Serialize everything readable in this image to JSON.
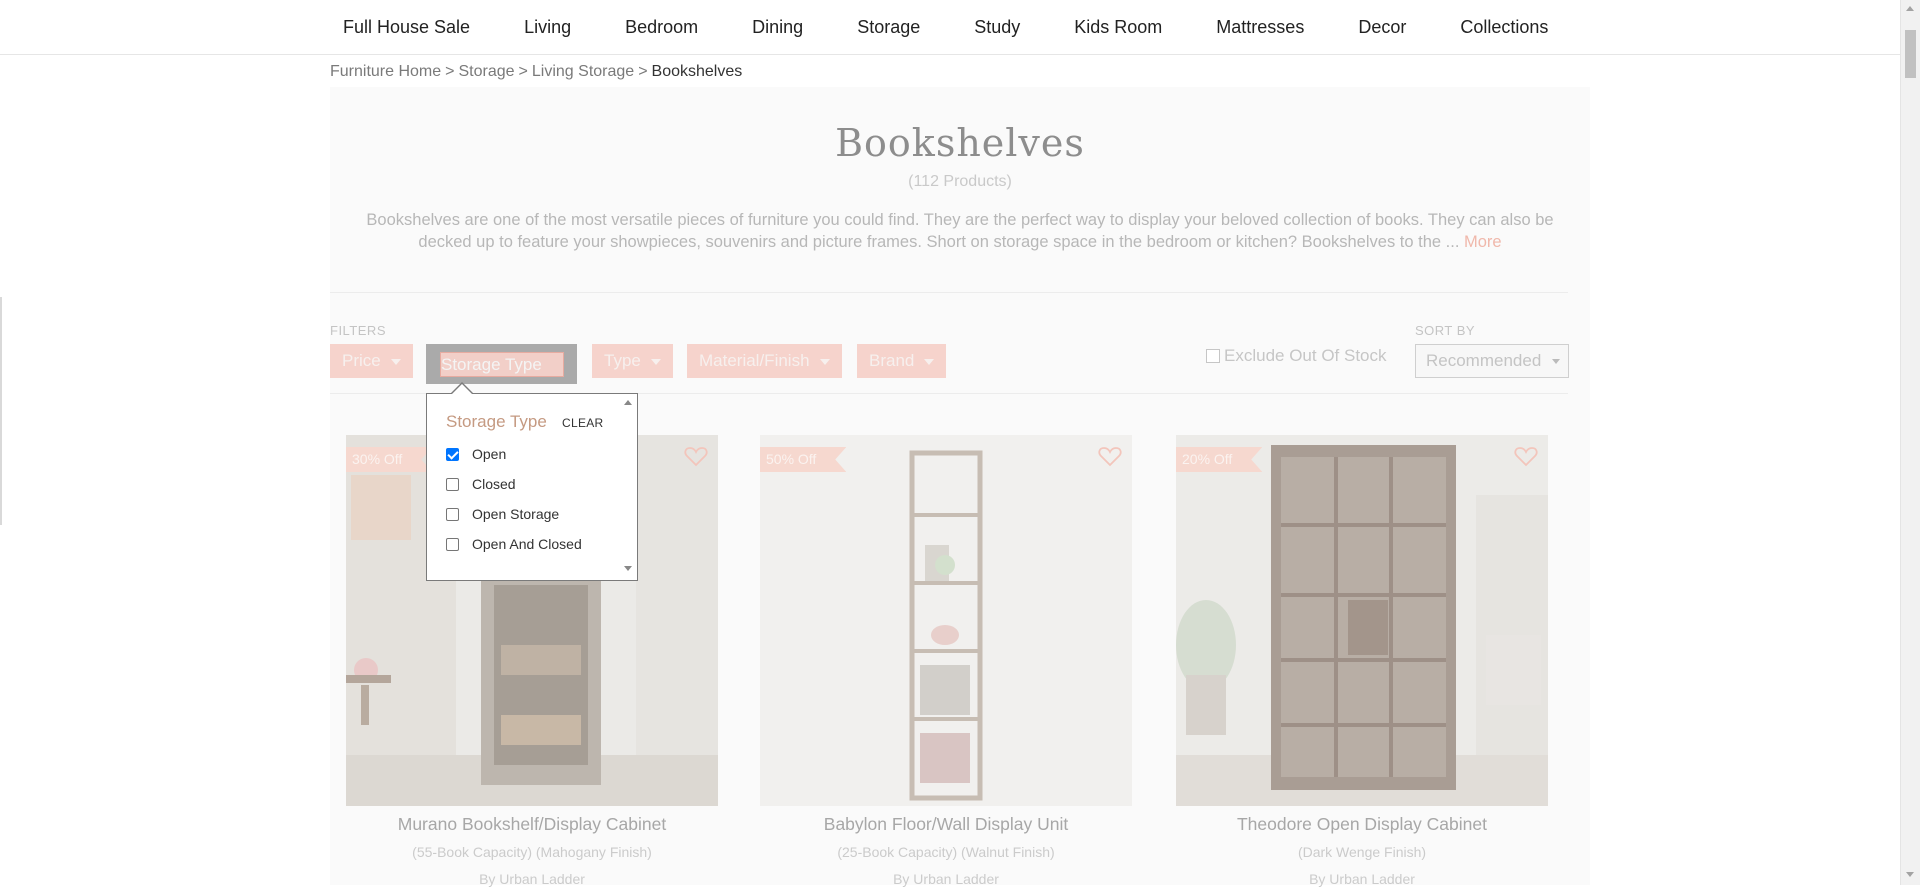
{
  "nav": {
    "items": [
      "Full House Sale",
      "Living",
      "Bedroom",
      "Dining",
      "Storage",
      "Study",
      "Kids Room",
      "Mattresses",
      "Decor",
      "Collections"
    ]
  },
  "breadcrumb": {
    "items": [
      "Furniture Home",
      "Storage",
      "Living Storage"
    ],
    "separator": ">",
    "current": "Bookshelves"
  },
  "header": {
    "title": "Bookshelves",
    "count": "(112 Products)",
    "description": "Bookshelves are one of the most versatile pieces of furniture you could find. They are the perfect way to display your beloved collection of books. They can also be decked up to feature your showpieces, souvenirs and picture frames. Short on storage space in the bedroom or kitchen? Bookshelves to the ...",
    "more_label": "More"
  },
  "filters": {
    "label": "FILTERS",
    "price": "Price",
    "storage_type": "Storage Type",
    "type": "Type",
    "material": "Material/Finish",
    "brand": "Brand",
    "exclude_out_of_stock": "Exclude Out Of Stock",
    "sort_label": "SORT BY",
    "sort_value": "Recommended"
  },
  "dropdown": {
    "title": "Storage Type",
    "clear_label": "CLEAR",
    "options": [
      {
        "label": "Open",
        "checked": true
      },
      {
        "label": "Closed",
        "checked": false
      },
      {
        "label": "Open Storage",
        "checked": false
      },
      {
        "label": "Open And Closed",
        "checked": false
      }
    ]
  },
  "products": [
    {
      "badge": "30% Off",
      "name": "Murano Bookshelf/Display Cabinet",
      "sub": "(55-Book Capacity) (Mahogany Finish)",
      "by": "By Urban Ladder"
    },
    {
      "badge": "50% Off",
      "name": "Babylon Floor/Wall Display Unit",
      "sub": "(25-Book Capacity) (Walnut Finish)",
      "by": "By Urban Ladder"
    },
    {
      "badge": "20% Off",
      "name": "Theodore Open Display Cabinet",
      "sub": "(Dark Wenge Finish)",
      "by": "By Urban Ladder"
    }
  ],
  "colors": {
    "accent": "#f6d3cc",
    "dropdown_title": "#c59a82",
    "checkbox": "#0075ff"
  }
}
